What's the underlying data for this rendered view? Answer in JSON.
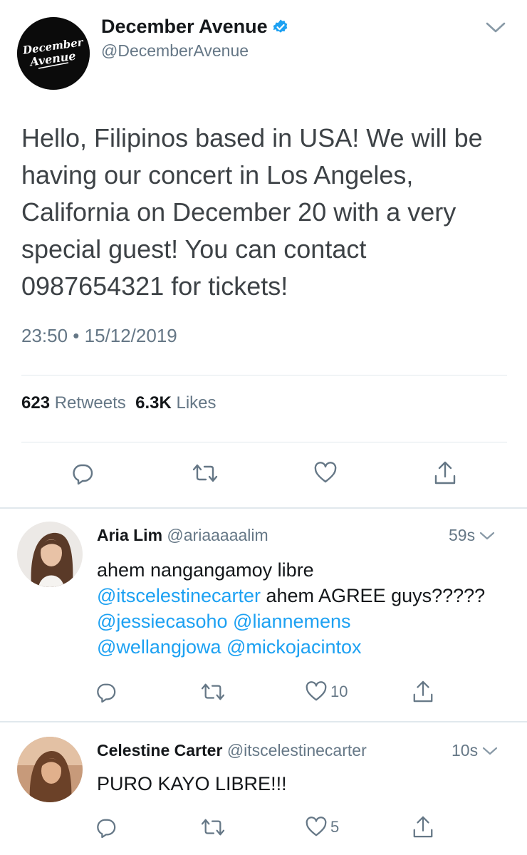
{
  "main_tweet": {
    "avatar_text": [
      "December",
      "Avenue"
    ],
    "name": "December Avenue",
    "handle": "@DecemberAvenue",
    "text": "Hello, Filipinos based in USA! We will be having our concert in Los Angeles, California on December 20 with a very special guest! You can contact 0987654321 for tickets!",
    "timestamp": "23:50 • 15/12/2019",
    "retweets_count": "623",
    "retweets_label": "Retweets",
    "likes_count": "6.3K",
    "likes_label": "Likes",
    "icons": [
      "reply-icon",
      "retweet-icon",
      "like-icon",
      "share-icon"
    ]
  },
  "replies": [
    {
      "name": "Aria Lim",
      "handle": "@ariaaaaalim",
      "time": "59s",
      "text_plain_1": "ahem nangangamoy libre",
      "mention_1": "@itscelestinecarter",
      "text_plain_2": " ahem AGREE guys????? ",
      "mention_2": "@jessiecasoho",
      "mention_3": "@liannemens",
      "mention_4": "@wellangjowa",
      "mention_5": "@mickojacintox",
      "like_count": "10"
    },
    {
      "name": "Celestine Carter",
      "handle": "@itscelestinecarter",
      "time": "10s",
      "text": "PURO KAYO LIBRE!!!",
      "like_count": "5"
    }
  ],
  "colors": {
    "link": "#1da1f2",
    "muted": "#657786",
    "text": "#14171a",
    "divider": "#e1e8ed",
    "verified": "#1da1f2"
  }
}
